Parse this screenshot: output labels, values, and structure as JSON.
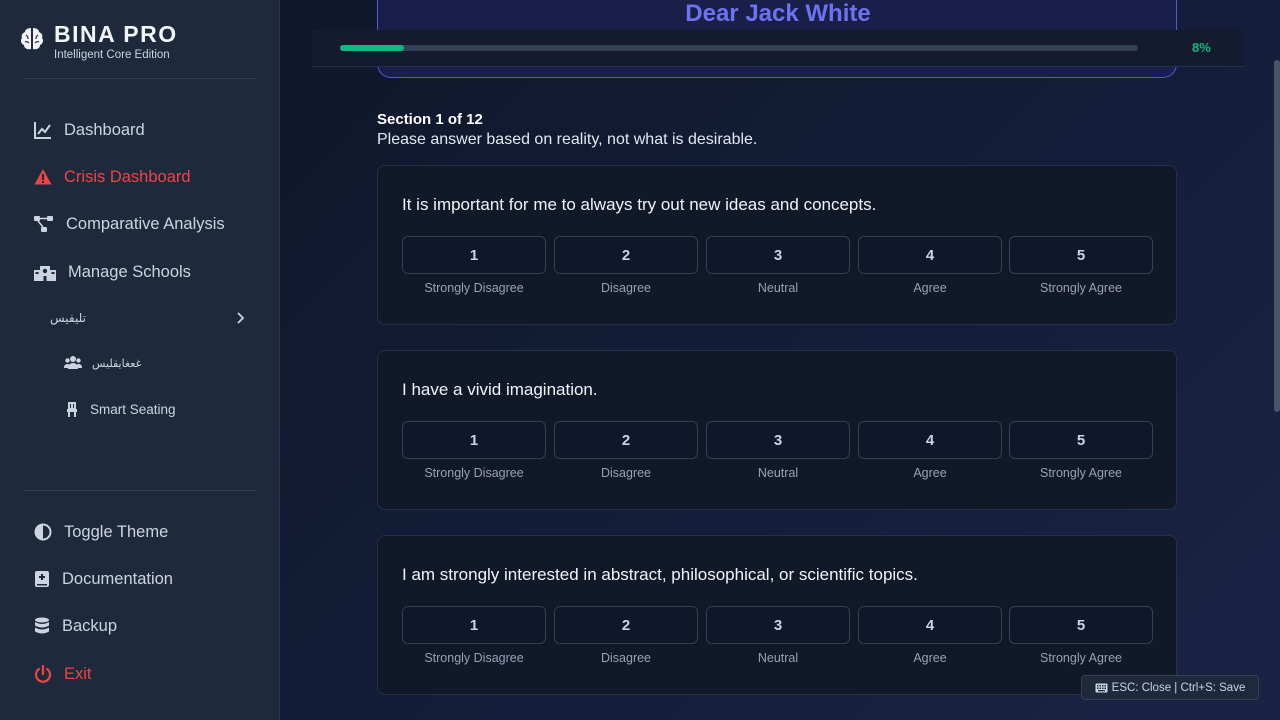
{
  "brand": {
    "title": "BINA PRO",
    "subtitle": "Intelligent Core Edition"
  },
  "nav": {
    "dashboard": "Dashboard",
    "crisis": "Crisis Dashboard",
    "comparative": "Comparative Analysis",
    "schools": "Manage Schools",
    "school_name": "تليفيس",
    "sub_class": "غعغايقليس",
    "smart_seating": "Smart Seating",
    "toggle_theme": "Toggle Theme",
    "documentation": "Documentation",
    "backup": "Backup",
    "exit": "Exit"
  },
  "header": {
    "greeting": "Dear Jack White"
  },
  "progress": {
    "percent": 8,
    "label": "8%"
  },
  "section": {
    "title": "Section 1 of 12",
    "description": "Please answer based on reality, not what is desirable."
  },
  "scale": [
    {
      "value": "1",
      "label": "Strongly Disagree"
    },
    {
      "value": "2",
      "label": "Disagree"
    },
    {
      "value": "3",
      "label": "Neutral"
    },
    {
      "value": "4",
      "label": "Agree"
    },
    {
      "value": "5",
      "label": "Strongly Agree"
    }
  ],
  "questions": [
    {
      "text": "It is important for me to always try out new ideas and concepts."
    },
    {
      "text": "I have a vivid imagination."
    },
    {
      "text": "I am strongly interested in abstract, philosophical, or scientific topics."
    }
  ],
  "hint": "ESC: Close | Ctrl+S: Save",
  "colors": {
    "accent": "#10b981",
    "danger": "#ef4444",
    "brand_purple": "#6d72f0"
  }
}
